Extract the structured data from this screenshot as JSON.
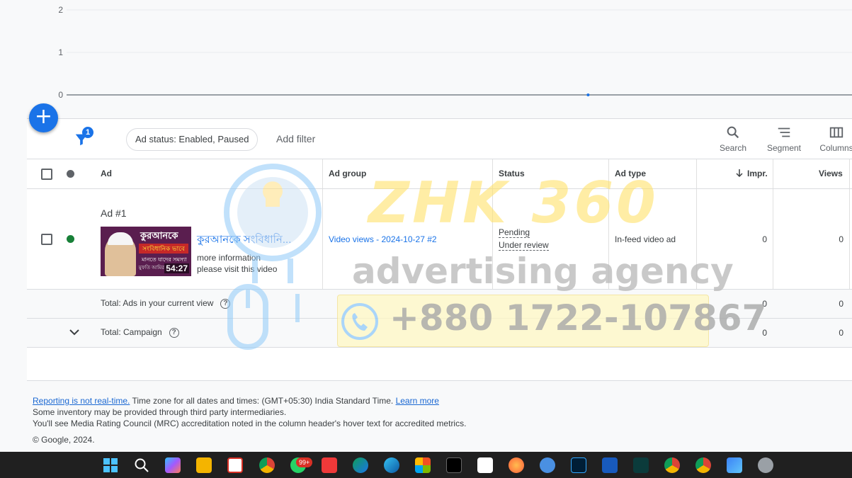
{
  "chart_data": {
    "type": "line",
    "y_ticks": [
      "2",
      "1",
      "0"
    ],
    "ylim": [
      0,
      2
    ],
    "points": [
      {
        "x": 0.664,
        "y": 0
      }
    ],
    "grid": true,
    "line_color": "#9aa0a6",
    "point_color": "#1a73e8"
  },
  "fab": {
    "label": "+"
  },
  "toolbar": {
    "filter_count": "1",
    "status_chip": "Ad status: Enabled, Paused",
    "add_filter": "Add filter",
    "search": "Search",
    "segment": "Segment",
    "columns": "Columns"
  },
  "table": {
    "headers": {
      "ad": "Ad",
      "ad_group": "Ad group",
      "status": "Status",
      "ad_type": "Ad type",
      "impr": "Impr.",
      "views": "Views"
    },
    "ad_row": {
      "ad_name": "Ad #1",
      "headline": "কুরআনকে সংবিধানি...",
      "desc1": "more information",
      "desc2": "please visit this video",
      "thumb_title": "কুরআনকে",
      "thumb_sub": "সংবিধানিক ভাবে",
      "thumb_sub2": "মানতে যাদের সমস্যা",
      "thumb_channel": "মুফতি আমির",
      "thumb_duration": "54:27",
      "ad_group": "Video views - 2024-10-27 #2",
      "status_1": "Pending",
      "status_2": "Under review",
      "ad_type": "In-feed video ad",
      "impr": "0",
      "views": "0",
      "status_color": "#188038"
    },
    "total_view": {
      "label": "Total: Ads in your current view",
      "impr": "0",
      "views": "0"
    },
    "total_campaign": {
      "label": "Total: Campaign",
      "impr": "0",
      "views": "0"
    }
  },
  "watermark": {
    "title": "ZHK 360",
    "subtitle": "advertising agency",
    "phone": "+880 1722-107867"
  },
  "footer": {
    "realtime_link": "Reporting is not real-time.",
    "timezone": " Time zone for all dates and times: (GMT+05:30) India Standard Time. ",
    "learn_more": "Learn more",
    "line2": "Some inventory may be provided through third party intermediaries.",
    "line3": "You'll see Media Rating Council (MRC) accreditation noted in the column header's hover text for accredited metrics.",
    "copyright": "© Google, 2024."
  },
  "taskbar": {
    "whatsapp_badge": "99+",
    "icons": [
      "windows-start-icon",
      "search-icon",
      "copilot-icon",
      "file-explorer-icon",
      "snipping-tool-icon",
      "chrome-icon",
      "whatsapp-icon",
      "vivaldi-icon",
      "edge-dev-icon",
      "edge-icon",
      "microsoft-store-icon",
      "capcut-pc-icon",
      "capcut-icon",
      "firefox-icon",
      "sync-icon",
      "photoshop-icon",
      "word-icon",
      "filmora-icon",
      "chrome-profile-icon",
      "chrome-profile-a-icon",
      "photos-icon",
      "settings-icon"
    ]
  }
}
